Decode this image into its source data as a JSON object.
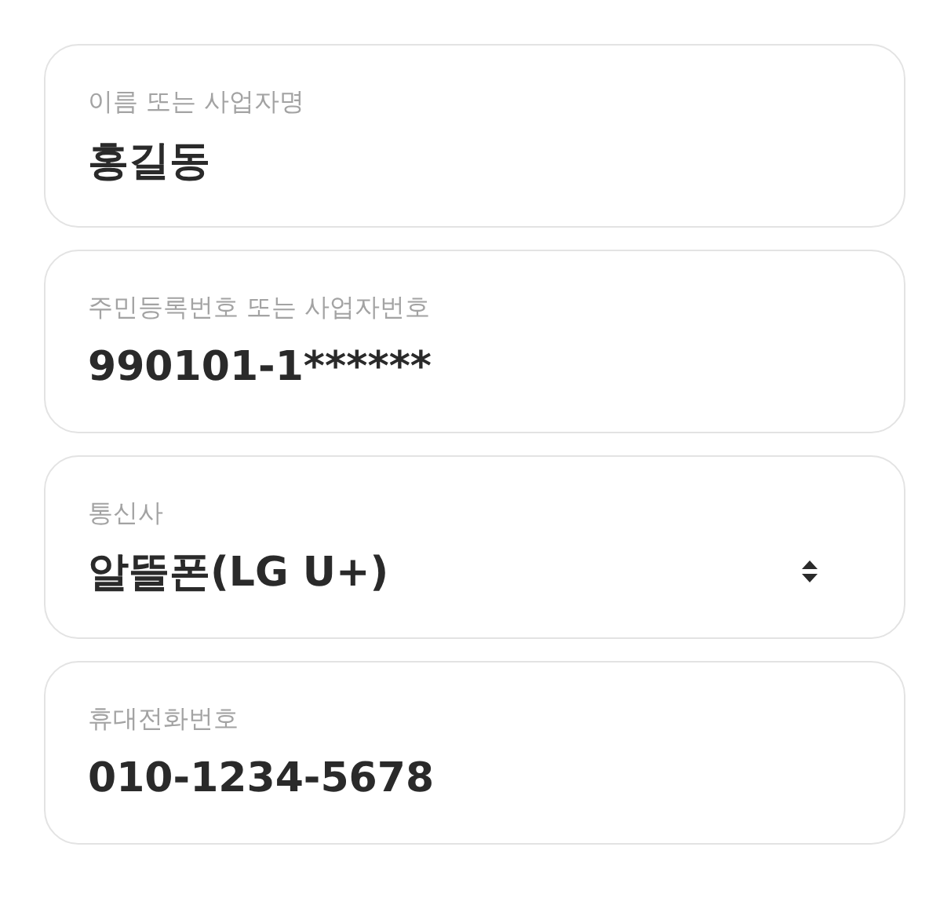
{
  "fields": [
    {
      "kind": "text",
      "label": "이름 또는 사업자명",
      "value": "홍길동"
    },
    {
      "kind": "text",
      "label": "주민등록번호 또는 사업자번호",
      "value": "990101-1******"
    },
    {
      "kind": "select",
      "label": "통신사",
      "value": "알뜰폰(LG U+)"
    },
    {
      "kind": "text",
      "label": "휴대전화번호",
      "value": "010-1234-5678"
    }
  ]
}
